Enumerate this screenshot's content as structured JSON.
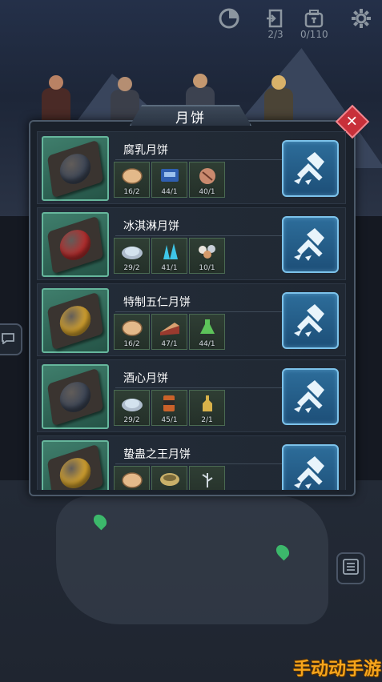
{
  "hud": {
    "timer_icon": "cooldown-dial-icon",
    "door_icon": "exit-door-icon",
    "door_count": "2/3",
    "bag_icon": "backpack-icon",
    "bag_count": "0/110",
    "settings_icon": "gear-icon"
  },
  "dialog": {
    "title": "月饼",
    "close_icon": "close-x-icon",
    "craft_icon": "hammer-craft-icon",
    "recipes": [
      {
        "name": "腐乳月饼",
        "cake_color": "#3d4656",
        "ingredients": [
          {
            "icon": "flatbread-icon",
            "count": "16/2",
            "color": "#e3b98a"
          },
          {
            "icon": "machine-part-icon",
            "count": "44/1",
            "color": "#2f5fb0"
          },
          {
            "icon": "meat-bundle-icon",
            "count": "40/1",
            "color": "#c98a6e"
          }
        ]
      },
      {
        "name": "冰淇淋月饼",
        "cake_color": "#b52d2d",
        "ingredients": [
          {
            "icon": "flour-plate-icon",
            "count": "29/2",
            "color": "#d3e2ee"
          },
          {
            "icon": "ice-crystal-icon",
            "count": "41/1",
            "color": "#3ec6e8"
          },
          {
            "icon": "egg-tray-icon",
            "count": "10/1",
            "color": "#e9e4dc"
          }
        ]
      },
      {
        "name": "特制五仁月饼",
        "cake_color": "#d4a22e",
        "ingredients": [
          {
            "icon": "flatbread-icon",
            "count": "16/2",
            "color": "#e3b98a"
          },
          {
            "icon": "cake-slice-icon",
            "count": "47/1",
            "color": "#9a3a2e"
          },
          {
            "icon": "potion-flask-icon",
            "count": "44/1",
            "color": "#5dc45a"
          }
        ]
      },
      {
        "name": "酒心月饼",
        "cake_color": "#3d4656",
        "ingredients": [
          {
            "icon": "flour-plate-icon",
            "count": "29/2",
            "color": "#d3e2ee"
          },
          {
            "icon": "liquor-can-icon",
            "count": "45/1",
            "color": "#c9622a"
          },
          {
            "icon": "wine-bottle-icon",
            "count": "2/1",
            "color": "#d8b24a"
          }
        ]
      },
      {
        "name": "蛰蛊之王月饼",
        "cake_color": "#d4a22e",
        "ingredients": [
          {
            "icon": "flatbread-icon",
            "count": "",
            "color": "#e3b98a"
          },
          {
            "icon": "bowl-icon",
            "count": "",
            "color": "#c9b06a"
          },
          {
            "icon": "herb-sprig-icon",
            "count": "",
            "color": "#cfd8de"
          }
        ]
      }
    ]
  },
  "watermark": "手动动手游"
}
